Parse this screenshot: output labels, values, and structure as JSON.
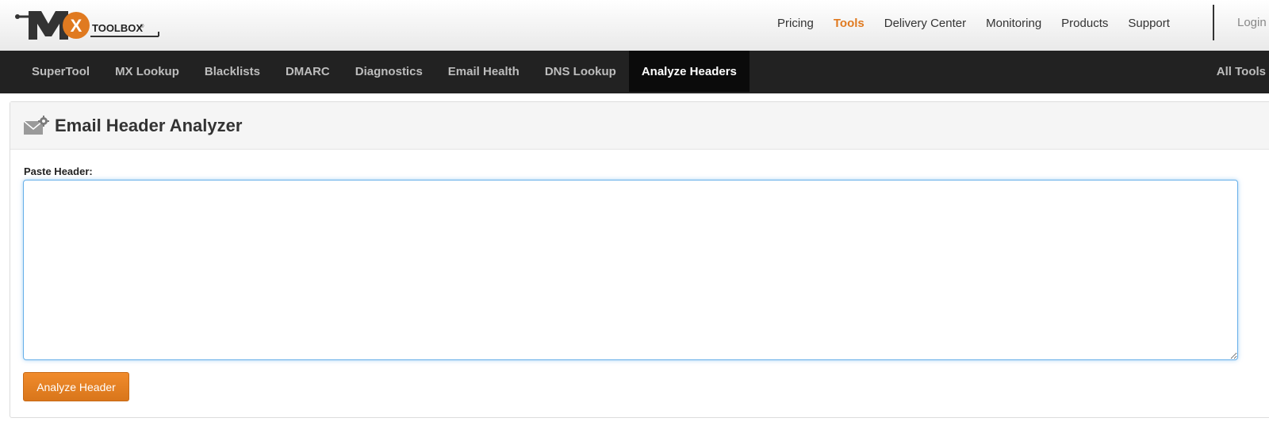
{
  "brand": {
    "logo_letters": "MX",
    "logo_wordmark": "TOOLBOX",
    "colors": {
      "accent_orange": "#e07a20",
      "dark_bar": "#222222",
      "active_tab": "#0b0b0b"
    }
  },
  "top_nav": {
    "items": [
      {
        "label": "Pricing",
        "active": false
      },
      {
        "label": "Tools",
        "active": true
      },
      {
        "label": "Delivery Center",
        "active": false
      },
      {
        "label": "Monitoring",
        "active": false
      },
      {
        "label": "Products",
        "active": false
      },
      {
        "label": "Support",
        "active": false
      }
    ],
    "login_label": "Login"
  },
  "tool_bar": {
    "tabs": [
      {
        "label": "SuperTool",
        "active": false
      },
      {
        "label": "MX Lookup",
        "active": false
      },
      {
        "label": "Blacklists",
        "active": false
      },
      {
        "label": "DMARC",
        "active": false
      },
      {
        "label": "Diagnostics",
        "active": false
      },
      {
        "label": "Email Health",
        "active": false
      },
      {
        "label": "DNS Lookup",
        "active": false
      },
      {
        "label": "Analyze Headers",
        "active": true
      }
    ],
    "all_tools_label": "All Tools"
  },
  "panel": {
    "icon": "email-settings-icon",
    "title": "Email Header Analyzer",
    "field_label": "Paste Header:",
    "textarea_value": "",
    "button_label": "Analyze Header"
  }
}
